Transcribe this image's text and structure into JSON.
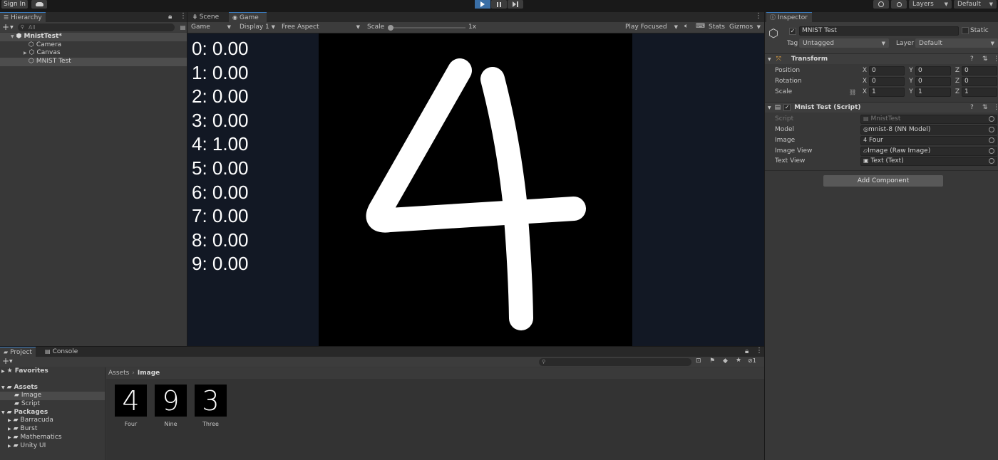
{
  "toolbar": {
    "sign_in": "Sign In",
    "layers": "Layers",
    "layout": "Default"
  },
  "hierarchy": {
    "tab": "Hierarchy",
    "search_placeholder": "All",
    "scene": "MnistTest*",
    "items": [
      "Camera",
      "Canvas",
      "MNIST Test"
    ]
  },
  "game_view": {
    "tabs": [
      "Scene",
      "Game"
    ],
    "mode": "Game",
    "display": "Display 1",
    "aspect": "Free Aspect",
    "scale_label": "Scale",
    "scale_value": "1x",
    "play_mode": "Play Focused",
    "stats": "Stats",
    "gizmos": "Gizmos",
    "scores": [
      "0: 0.00",
      "1: 0.00",
      "2: 0.00",
      "3: 0.00",
      "4: 1.00",
      "5: 0.00",
      "6: 0.00",
      "7: 0.00",
      "8: 0.00",
      "9: 0.00"
    ]
  },
  "inspector": {
    "tab": "Inspector",
    "object_name": "MNIST Test",
    "static_label": "Static",
    "tag_label": "Tag",
    "tag_value": "Untagged",
    "layer_label": "Layer",
    "layer_value": "Default",
    "transform": {
      "title": "Transform",
      "rows": [
        {
          "label": "Position",
          "x": "0",
          "y": "0",
          "z": "0"
        },
        {
          "label": "Rotation",
          "x": "0",
          "y": "0",
          "z": "0"
        },
        {
          "label": "Scale",
          "x": "1",
          "y": "1",
          "z": "1"
        }
      ]
    },
    "script_component": {
      "title": "Mnist Test (Script)",
      "fields": [
        {
          "label": "Script",
          "value": "MnistTest"
        },
        {
          "label": "Model",
          "value": "mnist-8 (NN Model)"
        },
        {
          "label": "Image",
          "value": "Four"
        },
        {
          "label": "Image View",
          "value": "Image (Raw Image)"
        },
        {
          "label": "Text View",
          "value": "Text (Text)"
        }
      ]
    },
    "add_component": "Add Component"
  },
  "project": {
    "tabs": [
      "Project",
      "Console"
    ],
    "hidden_count": "1",
    "favorites": "Favorites",
    "assets": "Assets",
    "asset_folders": [
      "Image",
      "Script"
    ],
    "packages": "Packages",
    "package_folders": [
      "Barracuda",
      "Burst",
      "Mathematics",
      "Unity UI"
    ],
    "breadcrumb": [
      "Assets",
      "Image"
    ],
    "thumbnails": [
      {
        "glyph": "4",
        "label": "Four"
      },
      {
        "glyph": "9",
        "label": "Nine"
      },
      {
        "glyph": "3",
        "label": "Three"
      }
    ]
  }
}
